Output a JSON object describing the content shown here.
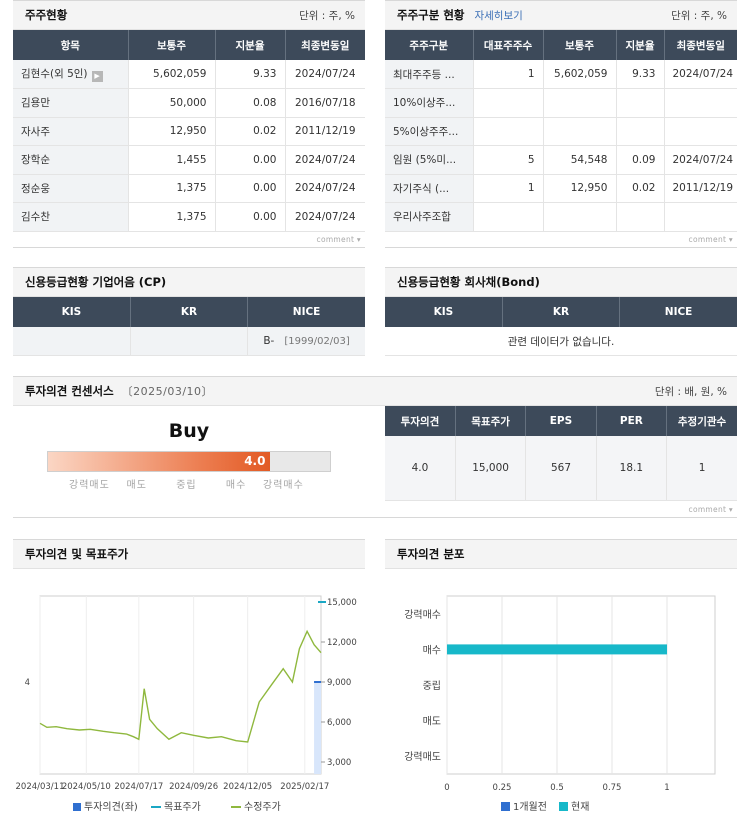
{
  "shareholders": {
    "title": "주주현황",
    "unit": "단위 : 주, %",
    "headers": [
      "항목",
      "보통주",
      "지분율",
      "최종변동일"
    ],
    "rows": [
      [
        "김현수(외 5인)",
        "5,602,059",
        "9.33",
        "2024/07/24"
      ],
      [
        "김용만",
        "50,000",
        "0.08",
        "2016/07/18"
      ],
      [
        "자사주",
        "12,950",
        "0.02",
        "2011/12/19"
      ],
      [
        "장학순",
        "1,455",
        "0.00",
        "2024/07/24"
      ],
      [
        "정순웅",
        "1,375",
        "0.00",
        "2024/07/24"
      ],
      [
        "김수찬",
        "1,375",
        "0.00",
        "2024/07/24"
      ]
    ],
    "comment": "comment"
  },
  "shareholder_types": {
    "title": "주주구분 현황",
    "link": "자세히보기",
    "unit": "단위 : 주, %",
    "headers": [
      "주주구분",
      "대표주주수",
      "보통주",
      "지분율",
      "최종변동일"
    ],
    "rows": [
      [
        "최대주주등 ...",
        "1",
        "5,602,059",
        "9.33",
        "2024/07/24"
      ],
      [
        "10%이상주...",
        "",
        "",
        "",
        ""
      ],
      [
        "5%이상주주...",
        "",
        "",
        "",
        ""
      ],
      [
        "임원 (5%미...",
        "5",
        "54,548",
        "0.09",
        "2024/07/24"
      ],
      [
        "자기주식 (...",
        "1",
        "12,950",
        "0.02",
        "2011/12/19"
      ],
      [
        "우리사주조합",
        "",
        "",
        "",
        ""
      ]
    ],
    "comment": "comment"
  },
  "credit_cp": {
    "title": "신용등급현황 기업어음 (CP)",
    "headers": [
      "KIS",
      "KR",
      "NICE"
    ],
    "kis": "",
    "kr": "",
    "nice_grade": "B-",
    "nice_date": "[1999/02/03]"
  },
  "credit_bond": {
    "title": "신용등급현황 회사채(Bond)",
    "headers": [
      "KIS",
      "KR",
      "NICE"
    ],
    "empty": "관련 데이터가 없습니다."
  },
  "consensus": {
    "title": "투자의견 컨센서스",
    "date": "〔2025/03/10〕",
    "unit": "단위 : 배, 원, %",
    "opinion": "Buy",
    "score": 4.0,
    "score_label": "4.0",
    "scale_labels": [
      "강력매도",
      "매도",
      "중립",
      "매수",
      "강력매수"
    ],
    "headers": [
      "투자의견",
      "목표주가",
      "EPS",
      "PER",
      "추정기관수"
    ],
    "values": [
      "4.0",
      "15,000",
      "567",
      "18.1",
      "1"
    ],
    "comment": "comment"
  },
  "chart_target_price": {
    "title": "투자의견 및 목표주가",
    "x_ticks": [
      "2024/03/11",
      "2024/05/10",
      "2024/07/17",
      "2024/09/26",
      "2024/12/05",
      "2025/02/17"
    ],
    "y_left_ticks": [
      "4"
    ],
    "y_right_ticks": [
      "15,000",
      "12,000",
      "9,000",
      "6,000",
      "3,000"
    ],
    "legend": [
      "투자의견(좌)",
      "목표주가",
      "수정주가"
    ],
    "colors": {
      "opinion": "#2f6fd0",
      "target": "#1aa7c4",
      "price": "#8fb83e"
    },
    "chart_data": {
      "type": "line",
      "x_range": [
        "2024/03/11",
        "2025/03/10"
      ],
      "ylim_right": [
        3000,
        15000
      ],
      "series": [
        {
          "name": "수정주가",
          "points": [
            [
              "2024/03/11",
              5900
            ],
            [
              "2024/03/20",
              5600
            ],
            [
              "2024/04/01",
              5650
            ],
            [
              "2024/04/15",
              5500
            ],
            [
              "2024/05/01",
              5400
            ],
            [
              "2024/05/15",
              5450
            ],
            [
              "2024/06/01",
              5300
            ],
            [
              "2024/06/15",
              5200
            ],
            [
              "2024/07/01",
              5100
            ],
            [
              "2024/07/10",
              4900
            ],
            [
              "2024/07/17",
              4700
            ],
            [
              "2024/07/24",
              8500
            ],
            [
              "2024/07/31",
              6200
            ],
            [
              "2024/08/10",
              5500
            ],
            [
              "2024/08/25",
              4700
            ],
            [
              "2024/09/10",
              5200
            ],
            [
              "2024/09/26",
              5000
            ],
            [
              "2024/10/15",
              4800
            ],
            [
              "2024/11/01",
              4900
            ],
            [
              "2024/11/20",
              4600
            ],
            [
              "2024/12/05",
              4500
            ],
            [
              "2024/12/20",
              7500
            ],
            [
              "2025/01/05",
              8800
            ],
            [
              "2025/01/20",
              10000
            ],
            [
              "2025/02/01",
              9000
            ],
            [
              "2025/02/10",
              11500
            ],
            [
              "2025/02/20",
              12800
            ],
            [
              "2025/03/01",
              11800
            ],
            [
              "2025/03/10",
              11200
            ]
          ]
        },
        {
          "name": "목표주가",
          "points": [
            [
              "2025/03/10",
              15000
            ]
          ]
        },
        {
          "name": "투자의견(좌)",
          "points": [
            [
              "2025/03/10",
              4
            ]
          ]
        }
      ]
    }
  },
  "chart_distribution": {
    "title": "투자의견 분포",
    "categories": [
      "강력매수",
      "매수",
      "중립",
      "매도",
      "강력매도"
    ],
    "x_ticks": [
      "0",
      "0.25",
      "0.5",
      "0.75",
      "1"
    ],
    "legend": [
      "1개월전",
      "현재"
    ],
    "colors": {
      "prev": "#2f6fd0",
      "now": "#17b8c9"
    },
    "chart_data": {
      "type": "bar",
      "categories": [
        "강력매수",
        "매수",
        "중립",
        "매도",
        "강력매도"
      ],
      "series": [
        {
          "name": "1개월전",
          "values": [
            0,
            0,
            0,
            0,
            0
          ]
        },
        {
          "name": "현재",
          "values": [
            0,
            1,
            0,
            0,
            0
          ]
        }
      ],
      "xlim": [
        0,
        1
      ]
    }
  }
}
